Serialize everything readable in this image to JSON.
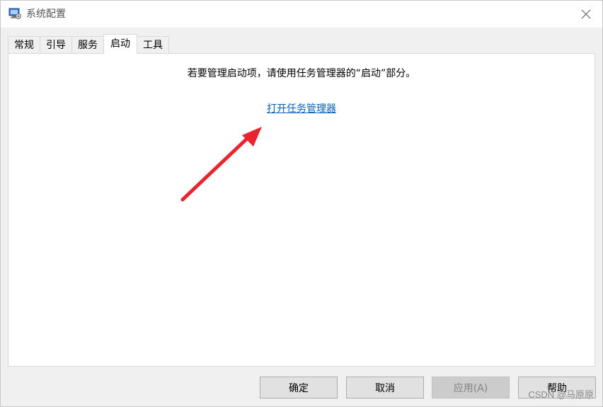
{
  "window": {
    "title": "系统配置",
    "close_glyph": "✕"
  },
  "tabs": [
    {
      "label": "常规",
      "active": false
    },
    {
      "label": "引导",
      "active": false
    },
    {
      "label": "服务",
      "active": false
    },
    {
      "label": "启动",
      "active": true
    },
    {
      "label": "工具",
      "active": false
    }
  ],
  "startup": {
    "info_text": "若要管理启动项，请使用任务管理器的“启动”部分。",
    "link_text": "打开任务管理器"
  },
  "buttons": {
    "ok": "确定",
    "cancel": "取消",
    "apply": "应用(A)",
    "help": "帮助"
  },
  "watermark": "CSDN @马原原",
  "colors": {
    "link": "#0a5fb4",
    "arrow": "#e8242f"
  }
}
